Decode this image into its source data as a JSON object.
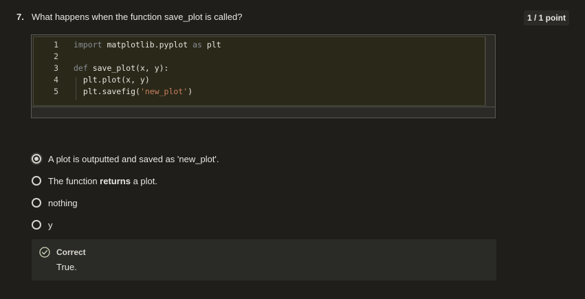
{
  "question": {
    "number": "7.",
    "text": "What happens when the function save_plot is called?",
    "points": "1 / 1 point"
  },
  "code": {
    "lines": [
      {
        "num": "1",
        "tokens": [
          {
            "t": "import",
            "c": "kw"
          },
          {
            "t": " matplotlib.pyplot ",
            "c": ""
          },
          {
            "t": "as",
            "c": "kw"
          },
          {
            "t": " plt",
            "c": ""
          }
        ]
      },
      {
        "num": "2",
        "tokens": []
      },
      {
        "num": "3",
        "tokens": [
          {
            "t": "def",
            "c": "kw"
          },
          {
            "t": " save_plot(x, y):",
            "c": ""
          }
        ]
      },
      {
        "num": "4",
        "tokens": [
          {
            "t": "  plt.plot(x, y)",
            "c": ""
          }
        ]
      },
      {
        "num": "5",
        "tokens": [
          {
            "t": "  plt.savefig(",
            "c": ""
          },
          {
            "t": "'new_plot'",
            "c": "str"
          },
          {
            "t": ")",
            "c": ""
          }
        ]
      }
    ]
  },
  "options": [
    {
      "label_parts": [
        {
          "t": "A plot is outputted and saved as 'new_plot'.",
          "b": false
        }
      ],
      "selected": true
    },
    {
      "label_parts": [
        {
          "t": "The function ",
          "b": false
        },
        {
          "t": "returns",
          "b": true
        },
        {
          "t": " a plot.",
          "b": false
        }
      ],
      "selected": false
    },
    {
      "label_parts": [
        {
          "t": "nothing",
          "b": false
        }
      ],
      "selected": false
    },
    {
      "label_parts": [
        {
          "t": "y",
          "b": false
        }
      ],
      "selected": false
    }
  ],
  "feedback": {
    "title": "Correct",
    "text": "True.",
    "icon": "check-circle-icon",
    "accent": "#cfd8b8"
  }
}
